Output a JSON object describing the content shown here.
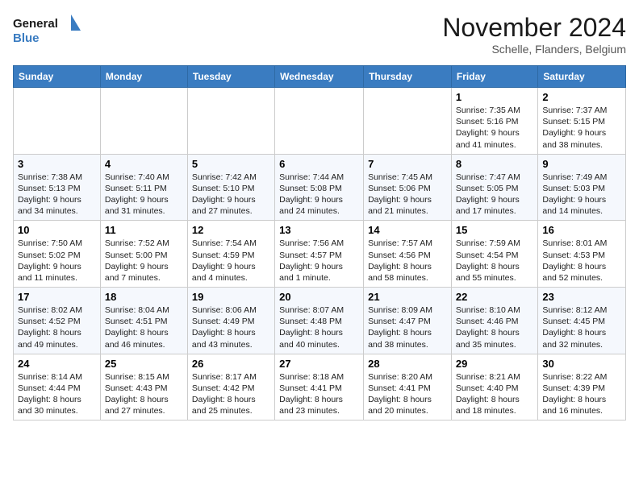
{
  "logo": {
    "line1": "General",
    "line2": "Blue"
  },
  "title": "November 2024",
  "subtitle": "Schelle, Flanders, Belgium",
  "days_of_week": [
    "Sunday",
    "Monday",
    "Tuesday",
    "Wednesday",
    "Thursday",
    "Friday",
    "Saturday"
  ],
  "weeks": [
    [
      {
        "day": "",
        "sunrise": "",
        "sunset": "",
        "daylight": ""
      },
      {
        "day": "",
        "sunrise": "",
        "sunset": "",
        "daylight": ""
      },
      {
        "day": "",
        "sunrise": "",
        "sunset": "",
        "daylight": ""
      },
      {
        "day": "",
        "sunrise": "",
        "sunset": "",
        "daylight": ""
      },
      {
        "day": "",
        "sunrise": "",
        "sunset": "",
        "daylight": ""
      },
      {
        "day": "1",
        "sunrise": "Sunrise: 7:35 AM",
        "sunset": "Sunset: 5:16 PM",
        "daylight": "Daylight: 9 hours and 41 minutes."
      },
      {
        "day": "2",
        "sunrise": "Sunrise: 7:37 AM",
        "sunset": "Sunset: 5:15 PM",
        "daylight": "Daylight: 9 hours and 38 minutes."
      }
    ],
    [
      {
        "day": "3",
        "sunrise": "Sunrise: 7:38 AM",
        "sunset": "Sunset: 5:13 PM",
        "daylight": "Daylight: 9 hours and 34 minutes."
      },
      {
        "day": "4",
        "sunrise": "Sunrise: 7:40 AM",
        "sunset": "Sunset: 5:11 PM",
        "daylight": "Daylight: 9 hours and 31 minutes."
      },
      {
        "day": "5",
        "sunrise": "Sunrise: 7:42 AM",
        "sunset": "Sunset: 5:10 PM",
        "daylight": "Daylight: 9 hours and 27 minutes."
      },
      {
        "day": "6",
        "sunrise": "Sunrise: 7:44 AM",
        "sunset": "Sunset: 5:08 PM",
        "daylight": "Daylight: 9 hours and 24 minutes."
      },
      {
        "day": "7",
        "sunrise": "Sunrise: 7:45 AM",
        "sunset": "Sunset: 5:06 PM",
        "daylight": "Daylight: 9 hours and 21 minutes."
      },
      {
        "day": "8",
        "sunrise": "Sunrise: 7:47 AM",
        "sunset": "Sunset: 5:05 PM",
        "daylight": "Daylight: 9 hours and 17 minutes."
      },
      {
        "day": "9",
        "sunrise": "Sunrise: 7:49 AM",
        "sunset": "Sunset: 5:03 PM",
        "daylight": "Daylight: 9 hours and 14 minutes."
      }
    ],
    [
      {
        "day": "10",
        "sunrise": "Sunrise: 7:50 AM",
        "sunset": "Sunset: 5:02 PM",
        "daylight": "Daylight: 9 hours and 11 minutes."
      },
      {
        "day": "11",
        "sunrise": "Sunrise: 7:52 AM",
        "sunset": "Sunset: 5:00 PM",
        "daylight": "Daylight: 9 hours and 7 minutes."
      },
      {
        "day": "12",
        "sunrise": "Sunrise: 7:54 AM",
        "sunset": "Sunset: 4:59 PM",
        "daylight": "Daylight: 9 hours and 4 minutes."
      },
      {
        "day": "13",
        "sunrise": "Sunrise: 7:56 AM",
        "sunset": "Sunset: 4:57 PM",
        "daylight": "Daylight: 9 hours and 1 minute."
      },
      {
        "day": "14",
        "sunrise": "Sunrise: 7:57 AM",
        "sunset": "Sunset: 4:56 PM",
        "daylight": "Daylight: 8 hours and 58 minutes."
      },
      {
        "day": "15",
        "sunrise": "Sunrise: 7:59 AM",
        "sunset": "Sunset: 4:54 PM",
        "daylight": "Daylight: 8 hours and 55 minutes."
      },
      {
        "day": "16",
        "sunrise": "Sunrise: 8:01 AM",
        "sunset": "Sunset: 4:53 PM",
        "daylight": "Daylight: 8 hours and 52 minutes."
      }
    ],
    [
      {
        "day": "17",
        "sunrise": "Sunrise: 8:02 AM",
        "sunset": "Sunset: 4:52 PM",
        "daylight": "Daylight: 8 hours and 49 minutes."
      },
      {
        "day": "18",
        "sunrise": "Sunrise: 8:04 AM",
        "sunset": "Sunset: 4:51 PM",
        "daylight": "Daylight: 8 hours and 46 minutes."
      },
      {
        "day": "19",
        "sunrise": "Sunrise: 8:06 AM",
        "sunset": "Sunset: 4:49 PM",
        "daylight": "Daylight: 8 hours and 43 minutes."
      },
      {
        "day": "20",
        "sunrise": "Sunrise: 8:07 AM",
        "sunset": "Sunset: 4:48 PM",
        "daylight": "Daylight: 8 hours and 40 minutes."
      },
      {
        "day": "21",
        "sunrise": "Sunrise: 8:09 AM",
        "sunset": "Sunset: 4:47 PM",
        "daylight": "Daylight: 8 hours and 38 minutes."
      },
      {
        "day": "22",
        "sunrise": "Sunrise: 8:10 AM",
        "sunset": "Sunset: 4:46 PM",
        "daylight": "Daylight: 8 hours and 35 minutes."
      },
      {
        "day": "23",
        "sunrise": "Sunrise: 8:12 AM",
        "sunset": "Sunset: 4:45 PM",
        "daylight": "Daylight: 8 hours and 32 minutes."
      }
    ],
    [
      {
        "day": "24",
        "sunrise": "Sunrise: 8:14 AM",
        "sunset": "Sunset: 4:44 PM",
        "daylight": "Daylight: 8 hours and 30 minutes."
      },
      {
        "day": "25",
        "sunrise": "Sunrise: 8:15 AM",
        "sunset": "Sunset: 4:43 PM",
        "daylight": "Daylight: 8 hours and 27 minutes."
      },
      {
        "day": "26",
        "sunrise": "Sunrise: 8:17 AM",
        "sunset": "Sunset: 4:42 PM",
        "daylight": "Daylight: 8 hours and 25 minutes."
      },
      {
        "day": "27",
        "sunrise": "Sunrise: 8:18 AM",
        "sunset": "Sunset: 4:41 PM",
        "daylight": "Daylight: 8 hours and 23 minutes."
      },
      {
        "day": "28",
        "sunrise": "Sunrise: 8:20 AM",
        "sunset": "Sunset: 4:41 PM",
        "daylight": "Daylight: 8 hours and 20 minutes."
      },
      {
        "day": "29",
        "sunrise": "Sunrise: 8:21 AM",
        "sunset": "Sunset: 4:40 PM",
        "daylight": "Daylight: 8 hours and 18 minutes."
      },
      {
        "day": "30",
        "sunrise": "Sunrise: 8:22 AM",
        "sunset": "Sunset: 4:39 PM",
        "daylight": "Daylight: 8 hours and 16 minutes."
      }
    ]
  ]
}
